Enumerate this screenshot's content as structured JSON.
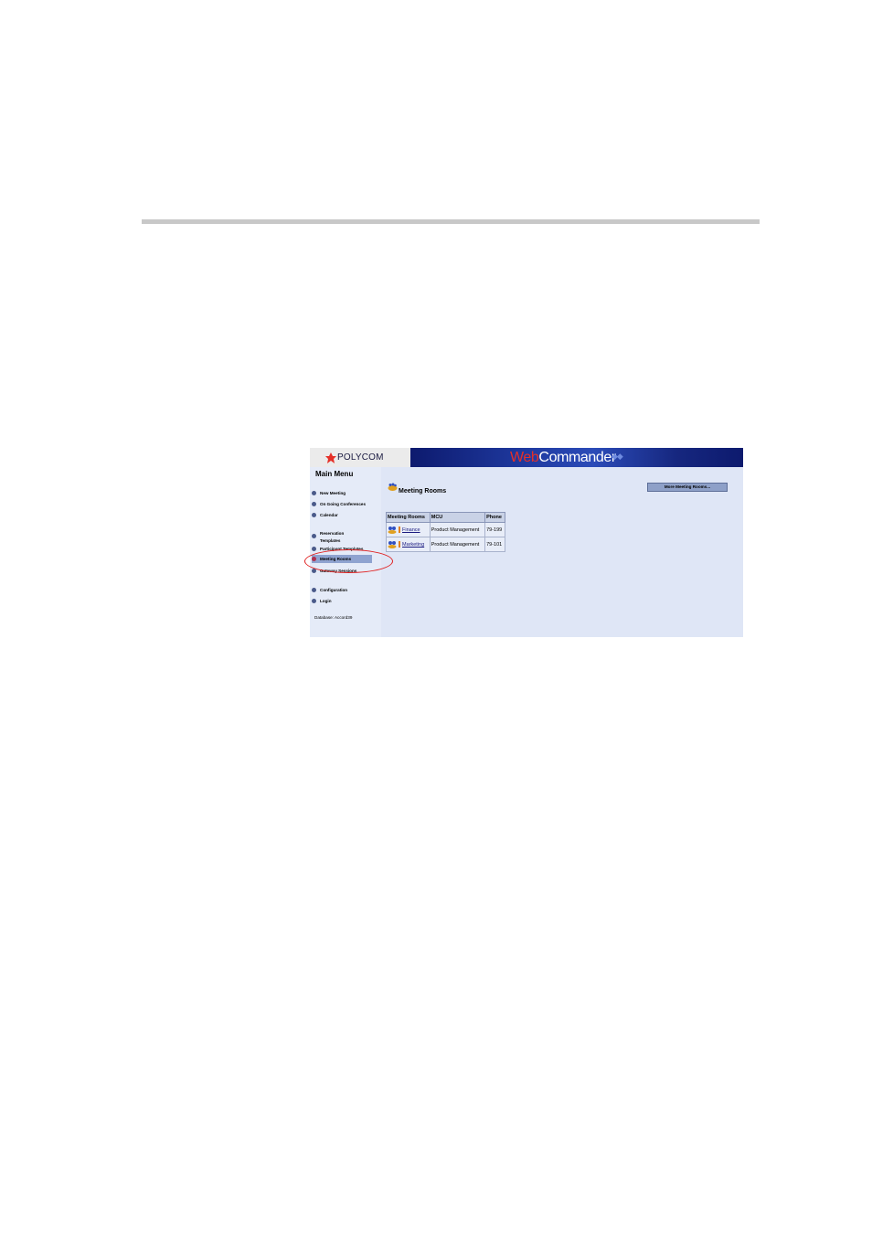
{
  "app": {
    "logo": "POLYCOM",
    "brand_web": "Web",
    "brand_commander": "Commander"
  },
  "sidebar": {
    "title": "Main Menu",
    "items": [
      {
        "label": "New Meeting"
      },
      {
        "label": "On Going Conferences"
      },
      {
        "label": "Calendar"
      },
      {
        "label": "Reservation Templates"
      },
      {
        "label": "Participant Templates"
      },
      {
        "label": "Meeting Rooms"
      },
      {
        "label": "Gateway Sessions"
      },
      {
        "label": "Configuration"
      },
      {
        "label": "Login"
      }
    ],
    "active_item": "Meeting Rooms",
    "database_label": "Database: Accord39"
  },
  "content": {
    "page_title": "Meeting Rooms",
    "more_button": "More Meeting Rooms...",
    "table": {
      "columns": [
        "Meeting Rooms",
        "MCU",
        "Phone"
      ],
      "rows": [
        {
          "name": "Finance",
          "mcu": "Product Management",
          "phone": "79-199"
        },
        {
          "name": "Marketing",
          "mcu": "Product Management",
          "phone": "79-101"
        }
      ]
    }
  },
  "colors": {
    "accent_red": "#e53028",
    "banner_blue": "#1f3aa0",
    "annotation": "#e02020"
  }
}
